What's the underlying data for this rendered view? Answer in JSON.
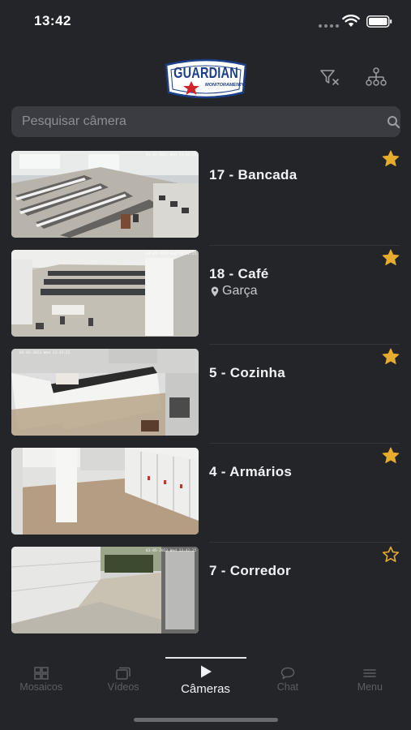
{
  "status_bar": {
    "time": "13:42"
  },
  "header": {
    "logo_text": "GUARDIAN",
    "logo_subtext": "MONITORAMENTO",
    "icons": [
      "filter-clear-icon",
      "hierarchy-icon"
    ]
  },
  "search": {
    "placeholder": "Pesquisar câmera",
    "value": ""
  },
  "cameras": [
    {
      "name": "17 - Bancada",
      "location": "",
      "favorite": true,
      "timestamp": "03-05-2023 Wed 13:42:25",
      "thumb": "office-desks"
    },
    {
      "name": "18 - Café",
      "location": "Garça",
      "favorite": true,
      "timestamp": "03-05-2023 Wed 13:42:25",
      "thumb": "cafe-hall"
    },
    {
      "name": "5 - Cozinha",
      "location": "",
      "favorite": true,
      "timestamp": "03-05-2023 Wed 13:42:25",
      "thumb": "kitchen"
    },
    {
      "name": "4 - Armários",
      "location": "",
      "favorite": true,
      "timestamp": "",
      "thumb": "lockers"
    },
    {
      "name": "7 - Corredor",
      "location": "",
      "favorite": false,
      "timestamp": "03-05-2023 Wed 13:42:25",
      "thumb": "corridor"
    }
  ],
  "tabs": [
    {
      "label": "Mosaicos",
      "icon": "grid-icon",
      "active": false
    },
    {
      "label": "Vídeos",
      "icon": "videos-icon",
      "active": false
    },
    {
      "label": "Câmeras",
      "icon": "play-icon",
      "active": true
    },
    {
      "label": "Chat",
      "icon": "chat-icon",
      "active": false
    },
    {
      "label": "Menu",
      "icon": "menu-icon",
      "active": false
    }
  ],
  "colors": {
    "background": "#242529",
    "star": "#e8ac2c",
    "search_bg": "#3b3c41",
    "logo_blue": "#1b3e86",
    "logo_red": "#d0232a"
  }
}
